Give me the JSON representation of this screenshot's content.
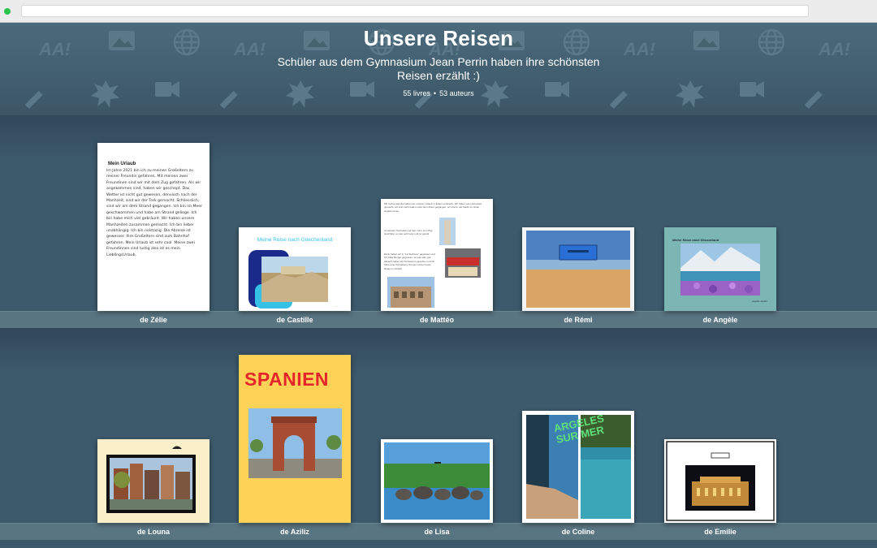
{
  "browser": {
    "status_color": "#2cc34a"
  },
  "header": {
    "title": "Unsere Reisen",
    "subtitle": "Schüler aus dem Gymnasium Jean Perrin haben ihre schönsten Reisen erzählt :)",
    "books_count": "55 livres",
    "separator": "•",
    "authors_count": "53 auteurs"
  },
  "books": [
    {
      "author": "de Zélie",
      "cover_title": "Mein Urlaub",
      "cover_text": "Im Jahre 2021 bin ich zu meinen Großeltern zu meiner Freundin gefahren. Mit meinen zwei Freundinen sind wir mit dem Zug gefahren. Als wir angekommen sind, haben wir geschopt. Das Wetter ist nicht gut gewesen, denvioch nach der Manhzeit, sind wir der Trek gemacht. Schliesslich, sind wir am dem Strand gegangen. Ich bin im Meer geschwommen und habe am Strand geliege. Ich bin habe mich viel gebräunt. Wir haben unsere Manhzeiten zusammen gemacht. Ich bin lieber unabhängig. Ich bin nolstazig. Die Abreise ist gewesser. Ihre Großeltern sind zum Bahnhof gefahren. Mein Urlaub ist sehr cool. Meine zwei Freundinnen sind lustig also ist es mein LieblingsUrlaub."
    },
    {
      "author": "de Castille",
      "cover_title": "Meine Reise nach Griechenland"
    },
    {
      "author": "de Mattéo",
      "cover_text_1": "Mit meiner Familie haben wir unseren Urlaub in Italien verbracht. Wir haben eine Autoreise gemacht, wir sind nach Italien nach dem Abitur gegangen, wir sind in der Nacht im Hotel angekommen.",
      "cover_text_2": "Am Ersten Tag haben wir den Turm von Pisa besichtigt, es war sehr lang und so genial",
      "cover_text_3": "Dann haben wir in \"La Stazione\" gegessen und ich habe Burger gegessen. es war sehr gut. danach haben wir Kolosseum gesehen und ich habe eine Vorstellung. Es war meiner beste Reise im Urlaub!"
    },
    {
      "author": "de Rémi"
    },
    {
      "author": "de Angèle",
      "cover_title": "Meine Reise nach Neuseeland",
      "cover_signature": "Angèle Jeukin"
    },
    {
      "author": "de Louna"
    },
    {
      "author": "de Aziliz",
      "cover_title": "SPANIEN"
    },
    {
      "author": "de Lisa"
    },
    {
      "author": "de Coline",
      "cover_title": "ARGELES SUR MER"
    },
    {
      "author": "de Emilie"
    }
  ],
  "colors": {
    "background": "#3d5a6c",
    "header_text": "#ffffff",
    "shelf_plank": "#597582",
    "spanien_cover": "#fdd257",
    "spanien_title": "#e4262b",
    "castille_accent": "#35c1e6"
  }
}
